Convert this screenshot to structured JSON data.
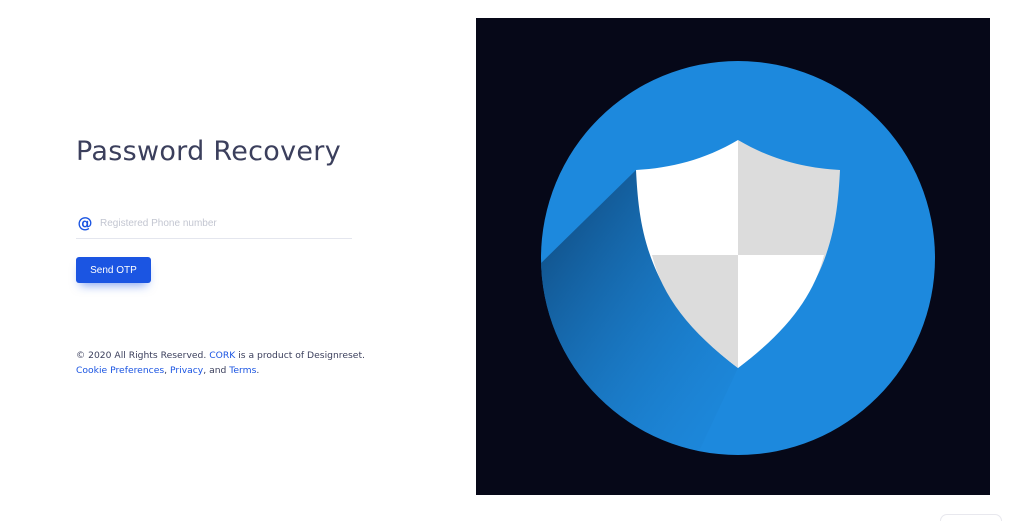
{
  "page": {
    "title": "Password Recovery"
  },
  "form": {
    "phone_placeholder": "Registered Phone number",
    "phone_value": "",
    "at_icon_glyph": "@",
    "submit_label": "Send OTP"
  },
  "footer": {
    "copyright": "© 2020 All Rights Reserved. ",
    "brand_link": "CORK",
    "product_text": " is a product of Designreset. ",
    "cookie_link": "Cookie Preferences",
    "sep1": ", ",
    "privacy_link": "Privacy",
    "sep2": ", and ",
    "terms_link": "Terms",
    "end": "."
  },
  "illustration": {
    "icon": "shield-icon",
    "background_color": "#060818",
    "circle_color": "#1d89dd",
    "accent_color": "#1b55e2"
  }
}
